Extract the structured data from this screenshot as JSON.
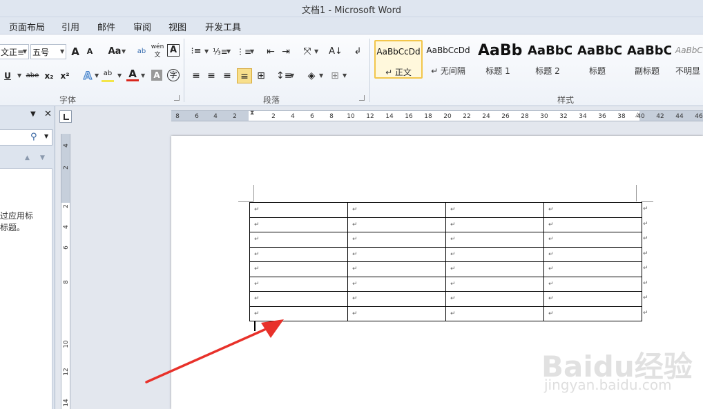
{
  "window": {
    "title": "文档1 - Microsoft Word"
  },
  "tabs": [
    "页面布局",
    "引用",
    "邮件",
    "审阅",
    "视图",
    "开发工具"
  ],
  "font_group": {
    "font_name": "文正≡",
    "font_size": "五号",
    "grow_label": "A",
    "shrink_label": "A",
    "case_label": "Aa",
    "underline_label": "U",
    "strike_label": "abe",
    "subscript_label": "x₂",
    "superscript_label": "x²",
    "label": "字体"
  },
  "paragraph_group": {
    "label": "段落"
  },
  "styles_group": {
    "label": "样式",
    "items": [
      {
        "sample": "AaBbCcDd",
        "name": "↵ 正文"
      },
      {
        "sample": "AaBbCcDd",
        "name": "↵ 无间隔"
      },
      {
        "sample": "AaBb",
        "name": "标题 1"
      },
      {
        "sample": "AaBbC",
        "name": "标题 2"
      },
      {
        "sample": "AaBbC",
        "name": "标题"
      },
      {
        "sample": "AaBbC",
        "name": "副标题"
      },
      {
        "sample": "AaBbCcI",
        "name": "不明显"
      }
    ]
  },
  "nav_pane": {
    "hint": "过应用标\n标题。"
  },
  "ruler": {
    "h_ticks": [
      "8",
      "6",
      "4",
      "2",
      "2",
      "4",
      "6",
      "8",
      "10",
      "12",
      "14",
      "16",
      "18",
      "20",
      "22",
      "24",
      "26",
      "28",
      "30",
      "32",
      "34",
      "36",
      "38",
      "40",
      "42",
      "44",
      "46"
    ],
    "v_ticks": [
      "4",
      "2",
      "2",
      "4",
      "6",
      "8",
      "10",
      "12",
      "14"
    ]
  },
  "table": {
    "rows": 8,
    "cols": 4,
    "cell_mark": "↵"
  },
  "watermark": {
    "logo": "Baidu经验",
    "url": "jingyan.baidu.com"
  },
  "colors": {
    "accent": "#f2c64b",
    "arrow": "#e8312a",
    "ribbon_bg": "#eef2f8",
    "font_color": "#d9261c"
  }
}
